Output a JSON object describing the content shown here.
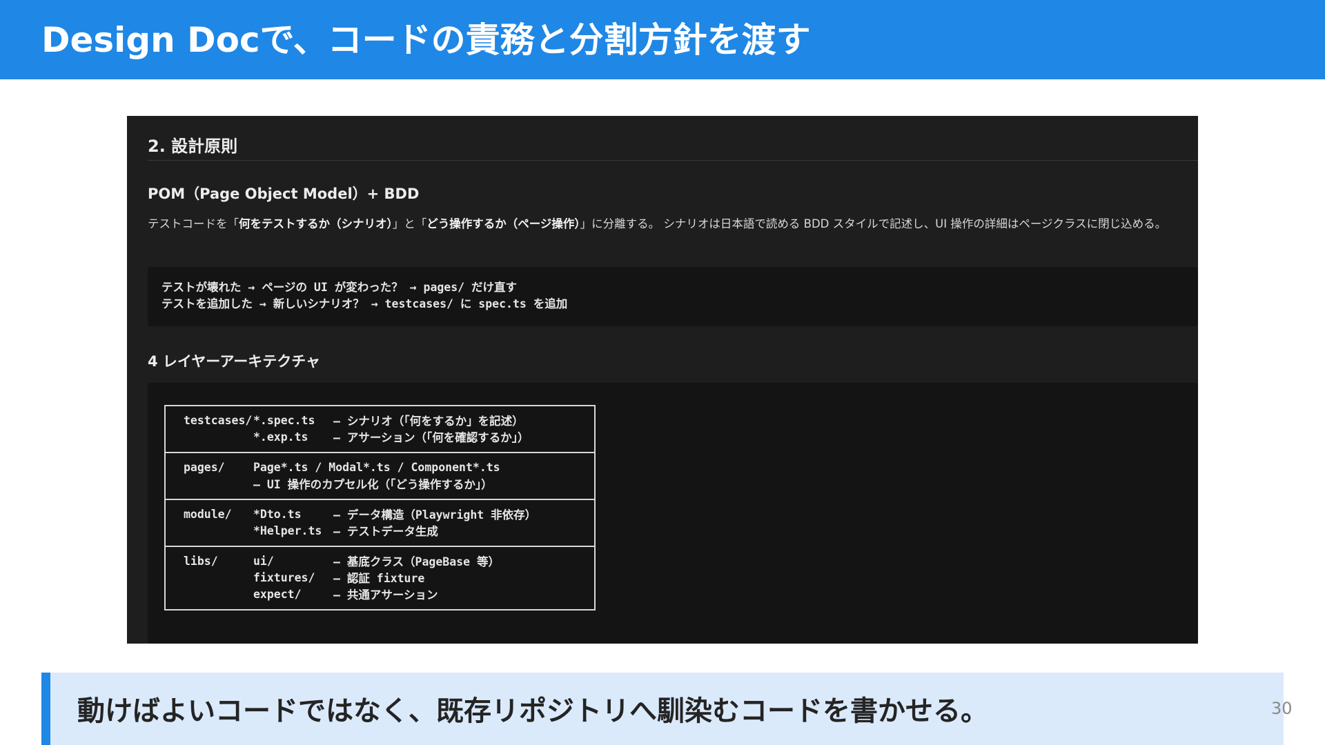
{
  "header": {
    "title": "Design Docで、コードの責務と分割方針を渡す"
  },
  "doc": {
    "section_heading": "2. 設計原則",
    "pom_heading": "POM（Page Object Model）+ BDD",
    "paragraph": {
      "t1": "テストコードを「",
      "b1": "何をテストするか（シナリオ）",
      "t2": "」と「",
      "b2": "どう操作するか（ページ操作）",
      "t3": "」に分離する。 シナリオは日本語で読める BDD スタイルで記述し、UI 操作の詳細はページクラスに閉じ込める。"
    },
    "code_lines": [
      "テストが壊れた → ページの UI が変わった？ → pages/ だけ直す",
      "テストを追加した → 新しいシナリオ？ → testcases/ に spec.ts を追加"
    ],
    "layer_heading": "4 レイヤーアーキテクチャ",
    "layers": [
      {
        "dir": "testcases/",
        "lines": [
          {
            "file": "*.spec.ts",
            "desc": "— シナリオ（「何をするか」を記述）"
          },
          {
            "file": "*.exp.ts",
            "desc": "— アサーション（「何を確認するか」）"
          }
        ]
      },
      {
        "dir": "pages/",
        "lines": [
          {
            "wide": "Page*.ts / Modal*.ts / Component*.ts"
          },
          {
            "wide": "— UI 操作のカプセル化（「どう操作するか」）"
          }
        ]
      },
      {
        "dir": "module/",
        "lines": [
          {
            "file": "*Dto.ts",
            "desc": "— データ構造（Playwright 非依存）"
          },
          {
            "file": "*Helper.ts",
            "desc": "— テストデータ生成"
          }
        ]
      },
      {
        "dir": "libs/",
        "lines": [
          {
            "file": "ui/",
            "desc": "— 基底クラス（PageBase 等）"
          },
          {
            "file": "fixtures/",
            "desc": "— 認証 fixture"
          },
          {
            "file": "expect/",
            "desc": "— 共通アサーション"
          }
        ]
      }
    ]
  },
  "callout": {
    "text": "動けばよいコードではなく、既存リポジトリへ馴染むコードを書かせる。"
  },
  "page_number": "30",
  "colors": {
    "header_bg": "#1f87e5",
    "panel_bg": "#1e1e1e",
    "code_bg": "#141414",
    "callout_bg": "#dbeafb",
    "callout_accent": "#1f87e5"
  }
}
